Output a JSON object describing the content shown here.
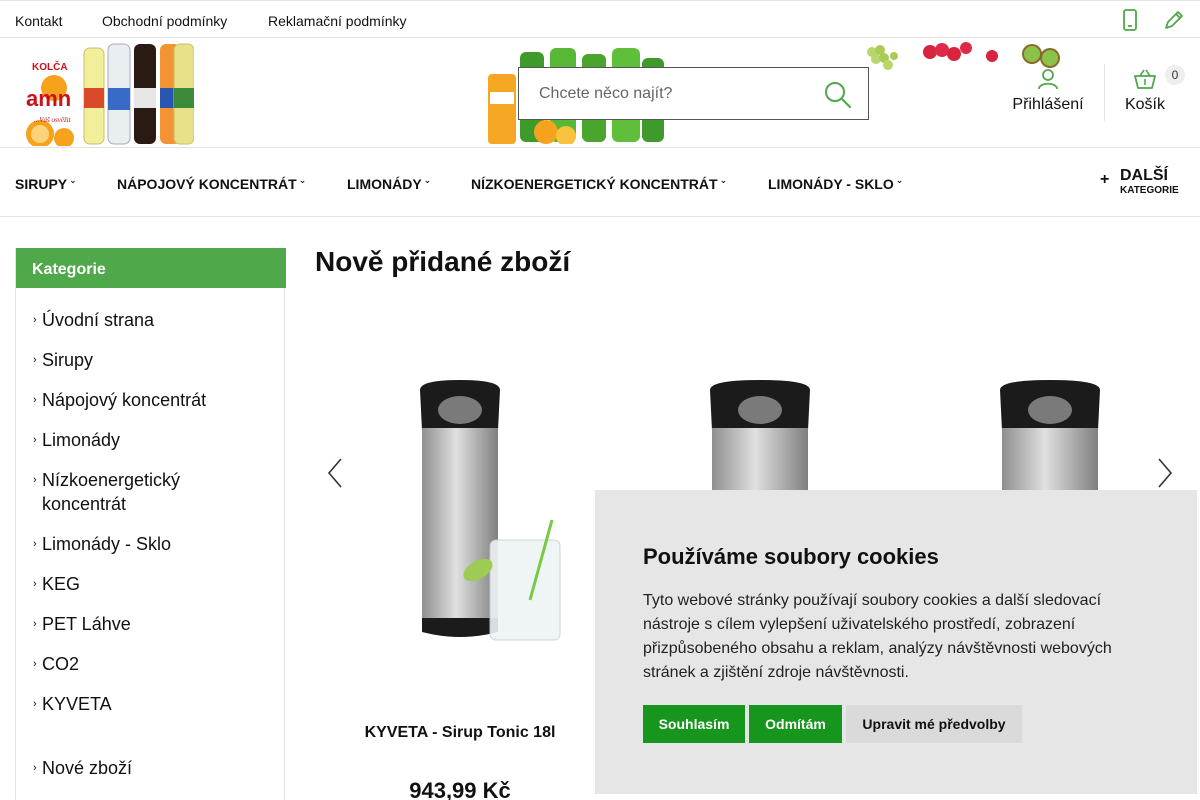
{
  "topbar": {
    "links": [
      "Kontakt",
      "Obchodní podmínky",
      "Reklamační podmínky"
    ]
  },
  "header": {
    "search_placeholder": "Chcete něco najít?",
    "login_label": "Přihlášení",
    "cart_label": "Košík",
    "cart_count": "0"
  },
  "nav": {
    "items": [
      "SIRUPY",
      "NÁPOJOVÝ KONCENTRÁT",
      "LIMONÁDY",
      "NÍZKOENERGETICKÝ KONCENTRÁT",
      "LIMONÁDY - SKLO"
    ],
    "more_big": "DALŠÍ",
    "more_small": "KATEGORIE"
  },
  "sidebar": {
    "heading": "Kategorie",
    "items": [
      "Úvodní strana",
      "Sirupy",
      "Nápojový koncentrát",
      "Limonády",
      "Nízkoenergetický koncentrát",
      "Limonády - Sklo",
      "KEG",
      "PET Láhve",
      "CO2",
      "KYVETA",
      "Nové zboží"
    ]
  },
  "main": {
    "title": "Nově přidané zboží",
    "products": [
      {
        "name": "KYVETA - Sirup Tonic 18l",
        "price": "943,99 Kč"
      },
      {
        "name": "",
        "price": ""
      },
      {
        "name": "",
        "price": ""
      }
    ]
  },
  "cookie": {
    "title": "Používáme soubory cookies",
    "text": "Tyto webové stránky používají soubory cookies a další sledovací nástroje s cílem vylepšení uživatelského prostředí, zobrazení přizpůsobeného obsahu a reklam, analýzy návštěvnosti webových stránek a zjištění zdroje návštěvnosti.",
    "accept": "Souhlasím",
    "reject": "Odmítám",
    "prefs": "Upravit mé předvolby"
  },
  "colors": {
    "accent_green": "#4fa84a",
    "button_green": "#17961e",
    "cookie_bg": "#e6e6e6"
  }
}
